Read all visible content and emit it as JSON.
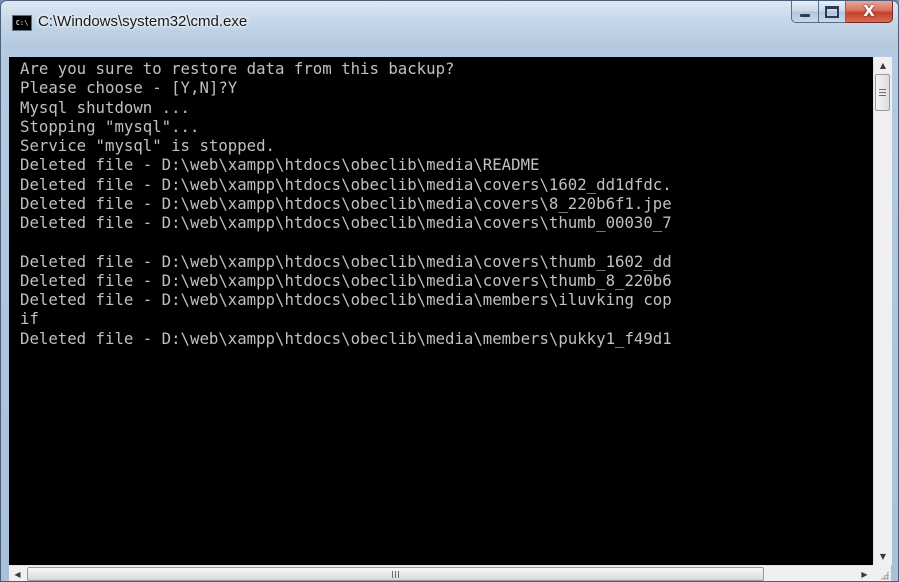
{
  "window": {
    "title": "C:\\Windows\\system32\\cmd.exe",
    "icon": "cmd-icon",
    "icon_text": "C:\\",
    "buttons": {
      "minimize_icon": "minimize-icon",
      "maximize_icon": "maximize-icon",
      "close_icon": "close-icon",
      "close_glyph": "X"
    }
  },
  "console": {
    "background": "#000000",
    "foreground": "#c0c0c0",
    "lines": [
      "Are you sure to restore data from this backup?",
      "Please choose - [Y,N]?Y",
      "Mysql shutdown ...",
      "Stopping \"mysql\"...",
      "Service \"mysql\" is stopped.",
      "Deleted file - D:\\web\\xampp\\htdocs\\obeclib\\media\\README",
      "Deleted file - D:\\web\\xampp\\htdocs\\obeclib\\media\\covers\\1602_dd1dfdc.",
      "Deleted file - D:\\web\\xampp\\htdocs\\obeclib\\media\\covers\\8_220b6f1.jpe",
      "Deleted file - D:\\web\\xampp\\htdocs\\obeclib\\media\\covers\\thumb_00030_7",
      "",
      "Deleted file - D:\\web\\xampp\\htdocs\\obeclib\\media\\covers\\thumb_1602_dd",
      "Deleted file - D:\\web\\xampp\\htdocs\\obeclib\\media\\covers\\thumb_8_220b6",
      "Deleted file - D:\\web\\xampp\\htdocs\\obeclib\\media\\members\\iluvking cop",
      "if",
      "Deleted file - D:\\web\\xampp\\htdocs\\obeclib\\media\\members\\pukky1_f49d1"
    ]
  },
  "scrollbars": {
    "vertical": {
      "up_icon": "up-arrow-icon",
      "down_icon": "down-arrow-icon",
      "position": 0.0
    },
    "horizontal": {
      "left_icon": "left-arrow-icon",
      "right_icon": "right-arrow-icon",
      "grip_label": "III",
      "position": 0.0
    }
  }
}
